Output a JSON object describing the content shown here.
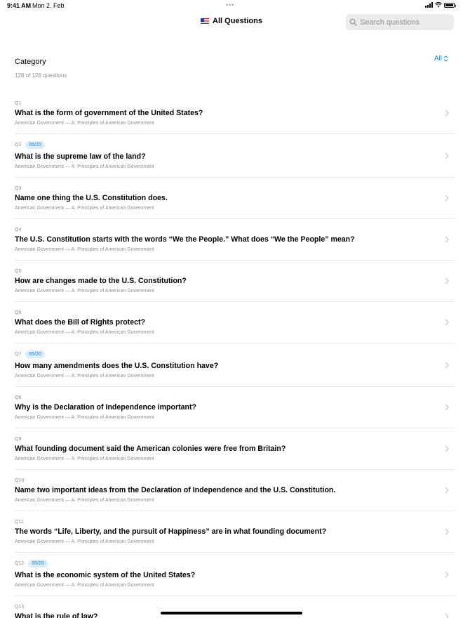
{
  "status": {
    "time": "9:41 AM",
    "date": "Mon 2. Feb",
    "dots": "•••"
  },
  "nav": {
    "title": "All Questions",
    "search_placeholder": "Search questions"
  },
  "filter": {
    "label": "Category",
    "value": "All",
    "count": "128 of 128 questions"
  },
  "colors": {
    "accent": "#1a84d8",
    "badge_bg": "#d8ecfb",
    "secondary": "#8e8e93",
    "divider": "#e6e6e8"
  },
  "questions": [
    {
      "num": "Q1",
      "badge": "",
      "text": "What is the form of government of the United States?",
      "sub": "American Government — A: Principles of American Government"
    },
    {
      "num": "Q2",
      "badge": "65/20",
      "text": "What is the supreme law of the land?",
      "sub": "American Government — A: Principles of American Government"
    },
    {
      "num": "Q3",
      "badge": "",
      "text": "Name one thing the U.S. Constitution does.",
      "sub": "American Government — A: Principles of American Government"
    },
    {
      "num": "Q4",
      "badge": "",
      "text": "The U.S. Constitution starts with the words “We the People.” What does “We the People” mean?",
      "sub": "American Government — A: Principles of American Government"
    },
    {
      "num": "Q5",
      "badge": "",
      "text": "How are changes made to the U.S. Constitution?",
      "sub": "American Government — A: Principles of American Government"
    },
    {
      "num": "Q6",
      "badge": "",
      "text": "What does the Bill of Rights protect?",
      "sub": "American Government — A: Principles of American Government"
    },
    {
      "num": "Q7",
      "badge": "65/20",
      "text": "How many amendments does the U.S. Constitution have?",
      "sub": "American Government — A: Principles of American Government"
    },
    {
      "num": "Q8",
      "badge": "",
      "text": "Why is the Declaration of Independence important?",
      "sub": "American Government — A: Principles of American Government"
    },
    {
      "num": "Q9",
      "badge": "",
      "text": "What founding document said the American colonies were free from Britain?",
      "sub": "American Government — A: Principles of American Government"
    },
    {
      "num": "Q10",
      "badge": "",
      "text": "Name two important ideas from the Declaration of Independence and the U.S. Constitution.",
      "sub": "American Government — A: Principles of American Government"
    },
    {
      "num": "Q11",
      "badge": "",
      "text": "The words “Life, Liberty, and the pursuit of Happiness” are in what founding document?",
      "sub": "American Government — A: Principles of American Government"
    },
    {
      "num": "Q12",
      "badge": "65/20",
      "text": "What is the economic system of the United States?",
      "sub": "American Government — A: Principles of American Government"
    },
    {
      "num": "Q13",
      "badge": "",
      "text": "What is the rule of law?",
      "sub": ""
    }
  ]
}
